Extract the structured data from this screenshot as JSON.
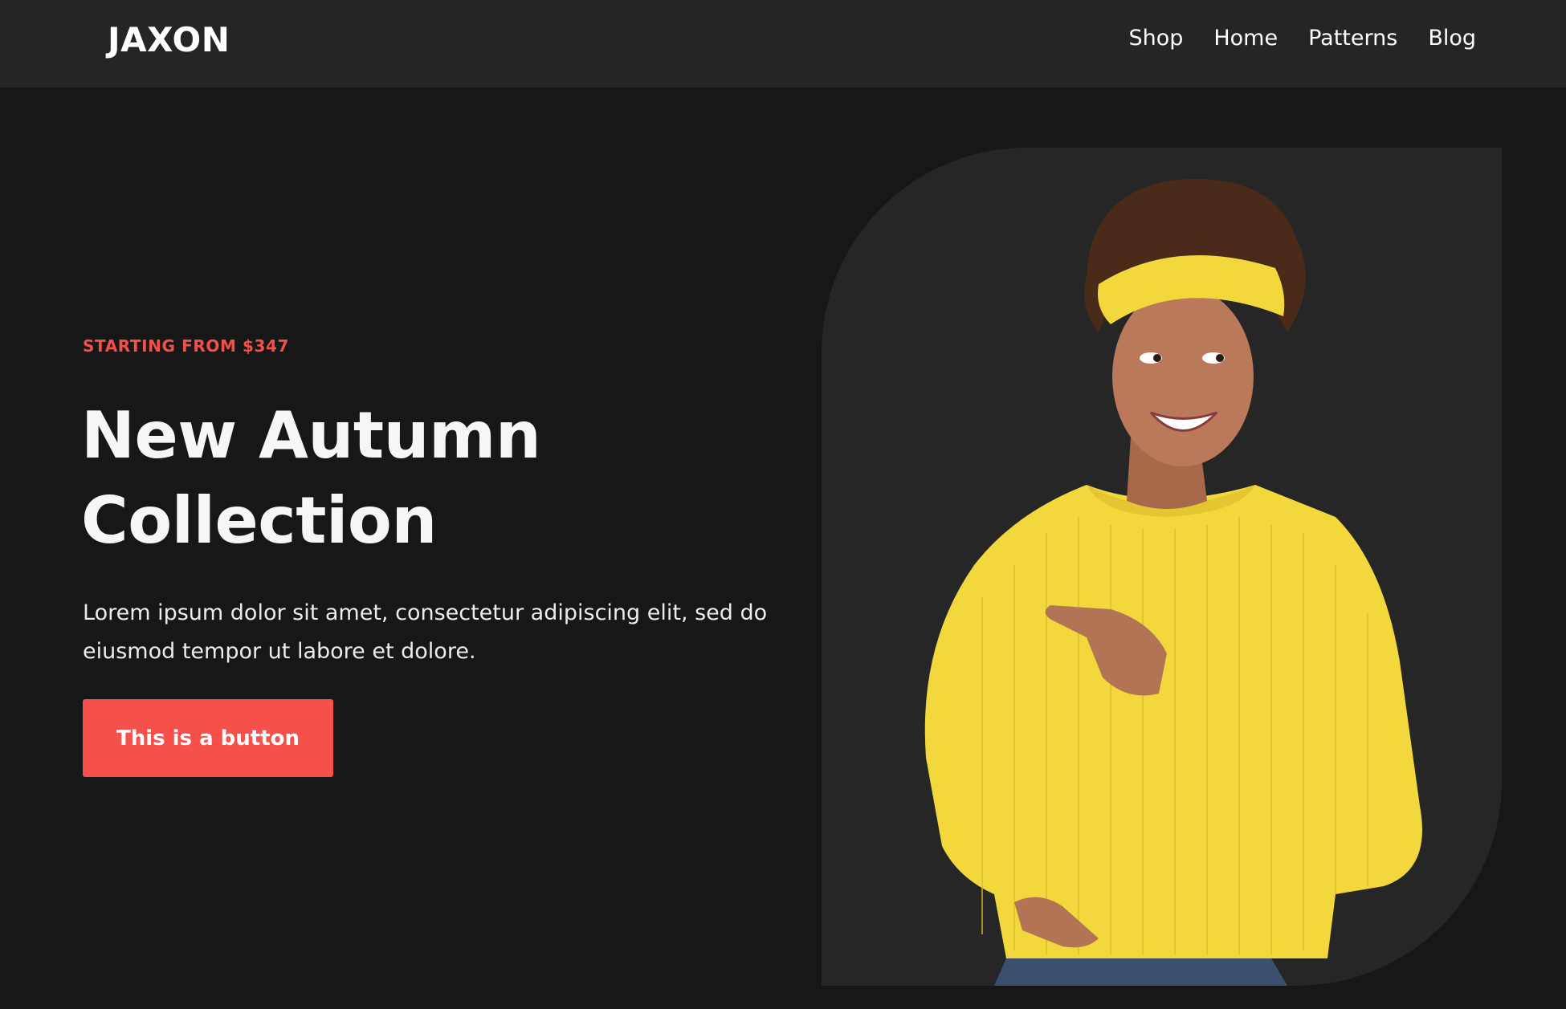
{
  "header": {
    "logo": "JAXON",
    "nav": [
      "Shop",
      "Home",
      "Patterns",
      "Blog"
    ]
  },
  "hero": {
    "eyebrow": "STARTING FROM $347",
    "headline_line1": "New Autumn",
    "headline_line2": "Collection",
    "body_line1": "Lorem ipsum dolor sit amet, consectetur adipiscing elit, sed do",
    "body_line2": "eiusmod tempor ut labore et dolore.",
    "button_label": "This is a button"
  },
  "colors": {
    "background": "#171717",
    "header": "#252525",
    "panel": "#262626",
    "accent": "#f5504a",
    "sweater": "#f2d83c"
  }
}
